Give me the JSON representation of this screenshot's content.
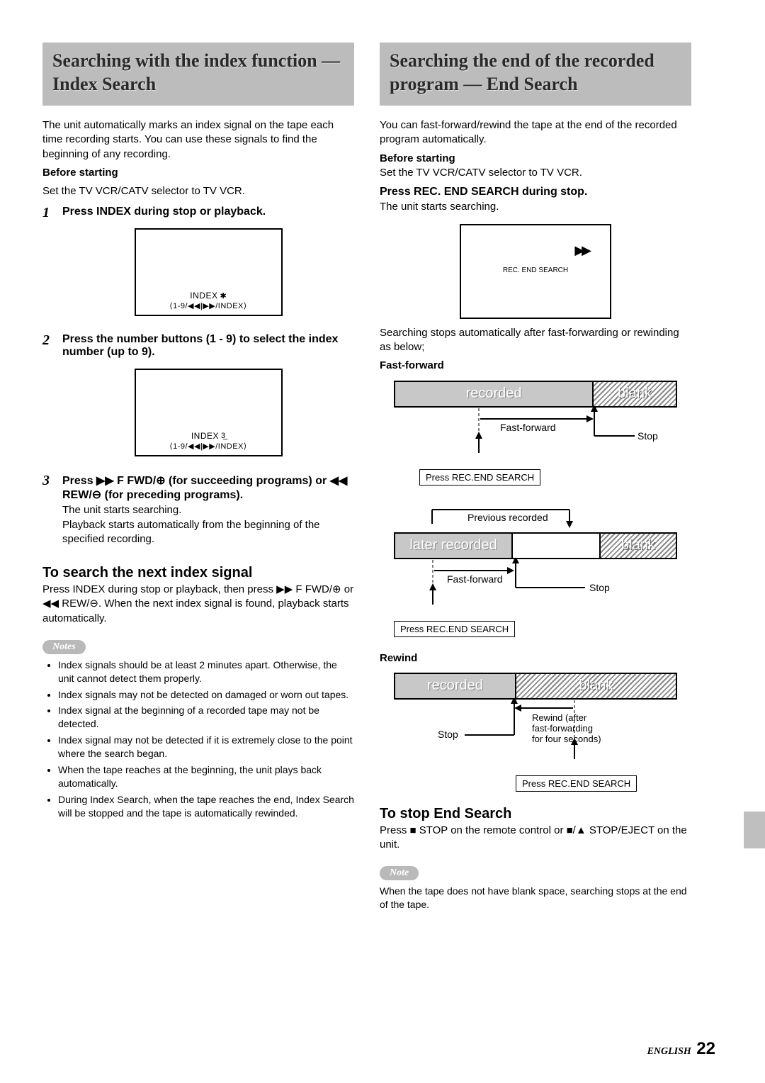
{
  "left": {
    "title": "Searching with the index function — Index Search",
    "intro": "The unit automatically marks an index signal on the tape each time recording starts. You can use these signals to find the beginning of any recording.",
    "before_h": "Before starting",
    "before_p": "Set the TV VCR/CATV selector to TV VCR.",
    "steps": [
      {
        "n": "1",
        "head": "Press INDEX during stop or playback.",
        "lcd_top_word": "INDEX",
        "lcd_top_sym": "✱",
        "lcd_bottom": "⟨1-9/◀◀|▶▶/INDEX⟩"
      },
      {
        "n": "2",
        "head": "Press the number buttons (1 - 9) to select the index number (up to 9).",
        "lcd_top_word": "INDEX",
        "lcd_top_sym": "3̲",
        "lcd_bottom": "⟨1-9/◀◀|▶▶/INDEX⟩"
      },
      {
        "n": "3",
        "head_a": "Press ▶▶ F FWD/⊕ (for succeeding programs) or ◀◀ REW/⊖ (for preceding programs).",
        "body": "The unit starts searching.\nPlayback starts automatically from the beginning of the specified recording."
      }
    ],
    "next_h": "To search the next index signal",
    "next_p": "Press INDEX during stop or playback, then press ▶▶ F FWD/⊕ or ◀◀ REW/⊖.  When the next index signal is found, playback starts automatically.",
    "notes_label": "Notes",
    "notes": [
      "Index signals should be at least 2 minutes apart. Otherwise, the unit cannot detect them properly.",
      "Index signals may not be detected on damaged or worn out tapes.",
      "Index signal at the beginning of a recorded tape may not be detected.",
      "Index signal may not be detected if it is extremely close to the point where the search began.",
      "When the tape reaches at the beginning, the unit plays back automatically.",
      "During Index Search, when the tape reaches the end, Index Search will be stopped and the tape is automatically rewinded."
    ]
  },
  "right": {
    "title": "Searching the end of the recorded program — End Search",
    "intro": "You can fast-forward/rewind the tape at the end of the recorded program automatically.",
    "before_h": "Before starting",
    "before_p": "Set the TV VCR/CATV selector to TV VCR.",
    "press_h": "Press REC. END SEARCH during stop.",
    "press_p": "The unit starts searching.",
    "endbox_icon": "▶▶",
    "endbox_label": "REC. END SEARCH",
    "after_p": "Searching stops automatically after fast-forwarding or rewinding as below;",
    "ff_h": "Fast-forward",
    "rw_h": "Rewind",
    "labels": {
      "recorded": "recorded",
      "blank": "blank",
      "later_recorded": "later recorded",
      "prev_recorded": "Previous recorded",
      "fast_forward": "Fast-forward",
      "stop": "Stop",
      "press_res": "Press REC.END SEARCH",
      "rewind_note": "Rewind (after\nfast-forwarding\nfor four seconds)"
    },
    "stop_h": "To stop End Search",
    "stop_p": "Press ■ STOP on the remote control or ■/▲ STOP/EJECT on the unit.",
    "note_label": "Note",
    "note_p": "When the tape does not have blank space, searching stops at the end of the tape."
  },
  "footer": {
    "lang": "ENGLISH",
    "page": "22"
  }
}
